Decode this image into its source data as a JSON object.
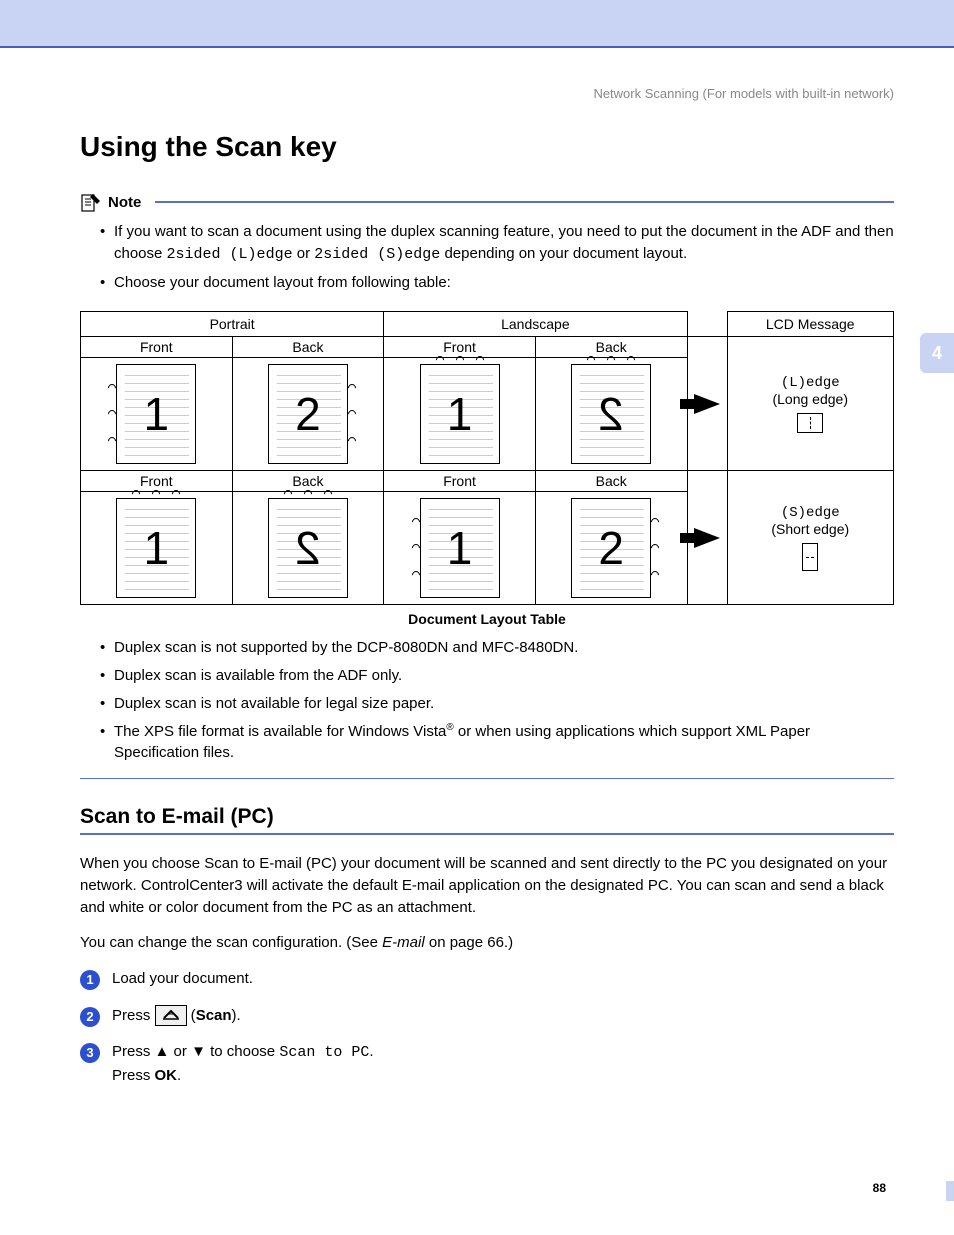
{
  "header": "Network Scanning (For models with built-in network)",
  "title": "Using the Scan key",
  "note_label": "Note",
  "tab_number": "4",
  "bullets_top": {
    "b1_part1": "If you want to scan a document using the duplex scanning feature, you need to put the document in the ADF and then choose ",
    "b1_mono1": "2sided (L)edge",
    "b1_mid": " or ",
    "b1_mono2": "2sided (S)edge",
    "b1_part2": " depending on your document layout.",
    "b2": "Choose your document layout from following table:"
  },
  "table": {
    "col_portrait": "Portrait",
    "col_landscape": "Landscape",
    "col_msg": "LCD Message",
    "front": "Front",
    "back": "Back",
    "msg1_mono": "(L)edge",
    "msg1_sub": "(Long edge)",
    "msg2_mono": "(S)edge",
    "msg2_sub": "(Short edge)",
    "caption": "Document Layout Table"
  },
  "bullets_bottom": {
    "b1": "Duplex scan is not supported by the DCP-8080DN and MFC-8480DN.",
    "b2": "Duplex scan is available from the ADF only.",
    "b3": "Duplex scan is not available for legal size paper.",
    "b4_part1": "The XPS file format is available for Windows Vista",
    "b4_sup": "®",
    "b4_part2": " or when using applications which support XML Paper Specification files."
  },
  "section2": {
    "heading": "Scan to E-mail (PC)",
    "p1": "When you choose Scan to E-mail (PC) your document will be scanned and sent directly to the PC you designated on your network. ControlCenter3 will activate the default E-mail application on the designated PC. You can scan and send a black and white or color document from the PC as an attachment.",
    "p2_part1": "You can change the scan configuration. (See ",
    "p2_italic": "E-mail",
    "p2_part2": " on page 66.)"
  },
  "steps": {
    "s1": "Load your document.",
    "s2_press": "Press ",
    "s2_paren_open": " (",
    "s2_scan": "Scan",
    "s2_paren_close": ").",
    "s3_part1": "Press ",
    "s3_up": "▲",
    "s3_or": " or ",
    "s3_down": "▼",
    "s3_part2": " to choose ",
    "s3_mono": "Scan to PC",
    "s3_part3": ".",
    "s3_line2a": "Press ",
    "s3_ok": "OK",
    "s3_line2b": "."
  },
  "page_number": "88"
}
